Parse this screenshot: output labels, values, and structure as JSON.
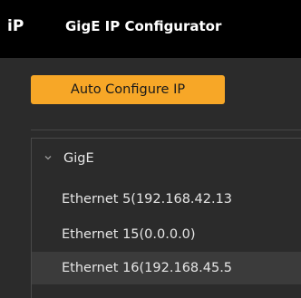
{
  "window": {
    "logo_text": "iP",
    "title": "GigE IP Configurator"
  },
  "toolbar": {
    "auto_configure_label": "Auto Configure IP"
  },
  "tree": {
    "group_label": "GigE",
    "group_icon": "chevron-down-icon",
    "items": [
      {
        "label": "Ethernet 5(192.168.42.13",
        "selected": false
      },
      {
        "label": "Ethernet 15(0.0.0.0)",
        "selected": false
      },
      {
        "label": "Ethernet 16(192.168.45.5",
        "selected": true
      }
    ]
  },
  "colors": {
    "accent": "#f7a727",
    "titlebar": "#000000",
    "background": "#2b2b2b",
    "selected_row": "#3b3b3b",
    "text": "#e6e6e6"
  }
}
